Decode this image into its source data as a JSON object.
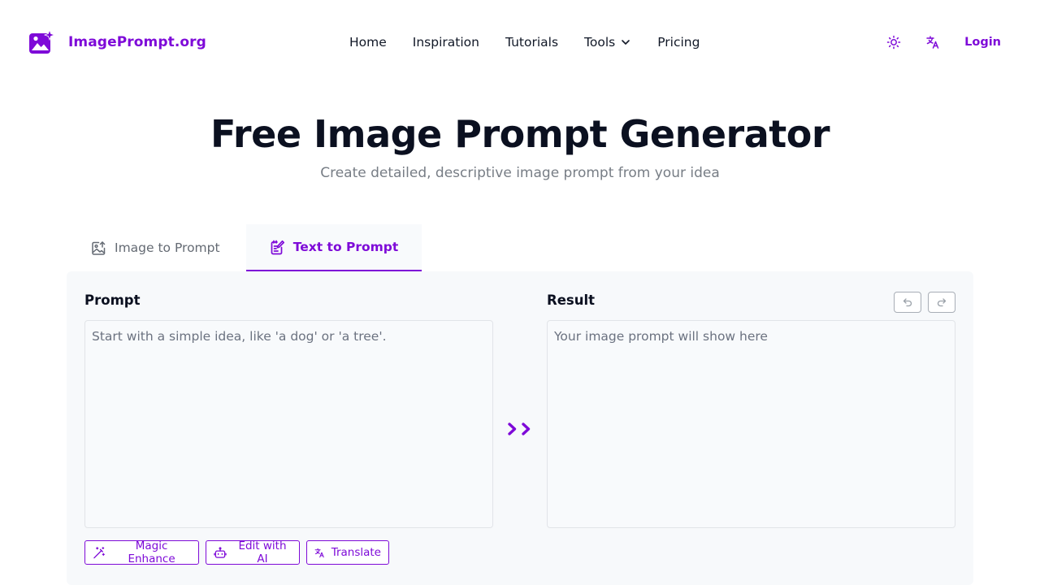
{
  "brand": {
    "name": "ImagePrompt.org",
    "accent": "#7e0ad8"
  },
  "nav": {
    "items": [
      {
        "label": "Home"
      },
      {
        "label": "Inspiration"
      },
      {
        "label": "Tutorials"
      },
      {
        "label": "Tools"
      },
      {
        "label": "Pricing"
      }
    ]
  },
  "header_actions": {
    "theme_icon": "sun-icon",
    "language_icon": "translate-icon",
    "login_label": "Login"
  },
  "hero": {
    "title": "Free Image Prompt Generator",
    "subtitle": "Create detailed, descriptive image prompt from your idea"
  },
  "tabs": [
    {
      "label": "Image to Prompt",
      "icon": "image-upload-icon",
      "active": false
    },
    {
      "label": "Text to Prompt",
      "icon": "note-edit-icon",
      "active": true
    }
  ],
  "prompt": {
    "label": "Prompt",
    "placeholder": "Start with a simple idea, like 'a dog' or 'a tree'."
  },
  "result": {
    "label": "Result",
    "placeholder": "Your image prompt will show here"
  },
  "tools": [
    {
      "label": "Magic Enhance",
      "icon": "magic-wand-icon"
    },
    {
      "label": "Edit with AI",
      "icon": "robot-icon"
    },
    {
      "label": "Translate",
      "icon": "translate-icon"
    }
  ]
}
